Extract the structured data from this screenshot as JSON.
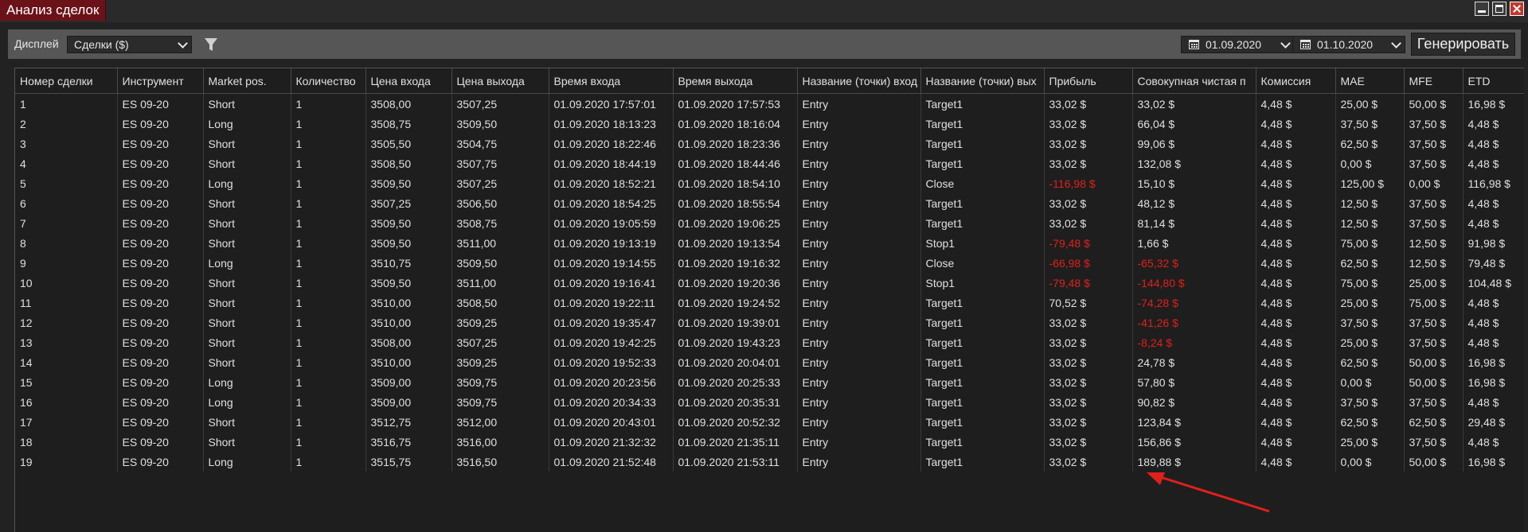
{
  "window": {
    "title": "Анализ сделок",
    "controls": [
      "minimize-icon",
      "maximize-icon",
      "close-icon"
    ]
  },
  "toolbar": {
    "display_label": "Дисплей",
    "display_value": "Сделки ($)",
    "filter_icon": "filter-icon",
    "date_from": "01.09.2020",
    "date_to": "01.10.2020",
    "generate_label": "Генерировать"
  },
  "table": {
    "columns": [
      "Номер сделки",
      "Инструмент",
      "Market pos.",
      "Количество",
      "Цена входа",
      "Цена выхода",
      "Время входа",
      "Время выхода",
      "Название (точки) вход",
      "Название (точки) вых",
      "Прибыль",
      "Совокупная чистая п",
      "Комиссия",
      "MAE",
      "MFE",
      "ETD"
    ],
    "rows": [
      [
        "1",
        "ES 09-20",
        "Short",
        "1",
        "3508,00",
        "3507,25",
        "01.09.2020 17:57:01",
        "01.09.2020 17:57:53",
        "Entry",
        "Target1",
        "33,02 $",
        "33,02 $",
        "4,48 $",
        "25,00 $",
        "50,00 $",
        "16,98 $"
      ],
      [
        "2",
        "ES 09-20",
        "Long",
        "1",
        "3508,75",
        "3509,50",
        "01.09.2020 18:13:23",
        "01.09.2020 18:16:04",
        "Entry",
        "Target1",
        "33,02 $",
        "66,04 $",
        "4,48 $",
        "37,50 $",
        "37,50 $",
        "4,48 $"
      ],
      [
        "3",
        "ES 09-20",
        "Short",
        "1",
        "3505,50",
        "3504,75",
        "01.09.2020 18:22:46",
        "01.09.2020 18:23:36",
        "Entry",
        "Target1",
        "33,02 $",
        "99,06 $",
        "4,48 $",
        "62,50 $",
        "37,50 $",
        "4,48 $"
      ],
      [
        "4",
        "ES 09-20",
        "Short",
        "1",
        "3508,50",
        "3507,75",
        "01.09.2020 18:44:19",
        "01.09.2020 18:44:46",
        "Entry",
        "Target1",
        "33,02 $",
        "132,08 $",
        "4,48 $",
        "0,00 $",
        "37,50 $",
        "4,48 $"
      ],
      [
        "5",
        "ES 09-20",
        "Long",
        "1",
        "3509,50",
        "3507,25",
        "01.09.2020 18:52:21",
        "01.09.2020 18:54:10",
        "Entry",
        "Close",
        "-116,98 $",
        "15,10 $",
        "4,48 $",
        "125,00 $",
        "0,00 $",
        "116,98 $"
      ],
      [
        "6",
        "ES 09-20",
        "Short",
        "1",
        "3507,25",
        "3506,50",
        "01.09.2020 18:54:25",
        "01.09.2020 18:55:54",
        "Entry",
        "Target1",
        "33,02 $",
        "48,12 $",
        "4,48 $",
        "12,50 $",
        "37,50 $",
        "4,48 $"
      ],
      [
        "7",
        "ES 09-20",
        "Short",
        "1",
        "3509,50",
        "3508,75",
        "01.09.2020 19:05:59",
        "01.09.2020 19:06:25",
        "Entry",
        "Target1",
        "33,02 $",
        "81,14 $",
        "4,48 $",
        "12,50 $",
        "37,50 $",
        "4,48 $"
      ],
      [
        "8",
        "ES 09-20",
        "Short",
        "1",
        "3509,50",
        "3511,00",
        "01.09.2020 19:13:19",
        "01.09.2020 19:13:54",
        "Entry",
        "Stop1",
        "-79,48 $",
        "1,66 $",
        "4,48 $",
        "75,00 $",
        "12,50 $",
        "91,98 $"
      ],
      [
        "9",
        "ES 09-20",
        "Long",
        "1",
        "3510,75",
        "3509,50",
        "01.09.2020 19:14:55",
        "01.09.2020 19:16:32",
        "Entry",
        "Close",
        "-66,98 $",
        "-65,32 $",
        "4,48 $",
        "62,50 $",
        "12,50 $",
        "79,48 $"
      ],
      [
        "10",
        "ES 09-20",
        "Short",
        "1",
        "3509,50",
        "3511,00",
        "01.09.2020 19:16:41",
        "01.09.2020 19:20:36",
        "Entry",
        "Stop1",
        "-79,48 $",
        "-144,80 $",
        "4,48 $",
        "75,00 $",
        "25,00 $",
        "104,48 $"
      ],
      [
        "11",
        "ES 09-20",
        "Short",
        "1",
        "3510,00",
        "3508,50",
        "01.09.2020 19:22:11",
        "01.09.2020 19:24:52",
        "Entry",
        "Target1",
        "70,52 $",
        "-74,28 $",
        "4,48 $",
        "25,00 $",
        "75,00 $",
        "4,48 $"
      ],
      [
        "12",
        "ES 09-20",
        "Short",
        "1",
        "3510,00",
        "3509,25",
        "01.09.2020 19:35:47",
        "01.09.2020 19:39:01",
        "Entry",
        "Target1",
        "33,02 $",
        "-41,26 $",
        "4,48 $",
        "37,50 $",
        "37,50 $",
        "4,48 $"
      ],
      [
        "13",
        "ES 09-20",
        "Short",
        "1",
        "3508,00",
        "3507,25",
        "01.09.2020 19:42:25",
        "01.09.2020 19:43:23",
        "Entry",
        "Target1",
        "33,02 $",
        "-8,24 $",
        "4,48 $",
        "25,00 $",
        "37,50 $",
        "4,48 $"
      ],
      [
        "14",
        "ES 09-20",
        "Short",
        "1",
        "3510,00",
        "3509,25",
        "01.09.2020 19:52:33",
        "01.09.2020 20:04:01",
        "Entry",
        "Target1",
        "33,02 $",
        "24,78 $",
        "4,48 $",
        "62,50 $",
        "50,00 $",
        "16,98 $"
      ],
      [
        "15",
        "ES 09-20",
        "Long",
        "1",
        "3509,00",
        "3509,75",
        "01.09.2020 20:23:56",
        "01.09.2020 20:25:33",
        "Entry",
        "Target1",
        "33,02 $",
        "57,80 $",
        "4,48 $",
        "0,00 $",
        "50,00 $",
        "16,98 $"
      ],
      [
        "16",
        "ES 09-20",
        "Long",
        "1",
        "3509,00",
        "3509,75",
        "01.09.2020 20:34:33",
        "01.09.2020 20:35:31",
        "Entry",
        "Target1",
        "33,02 $",
        "90,82 $",
        "4,48 $",
        "37,50 $",
        "37,50 $",
        "4,48 $"
      ],
      [
        "17",
        "ES 09-20",
        "Short",
        "1",
        "3512,75",
        "3512,00",
        "01.09.2020 20:43:01",
        "01.09.2020 20:52:32",
        "Entry",
        "Target1",
        "33,02 $",
        "123,84 $",
        "4,48 $",
        "62,50 $",
        "62,50 $",
        "29,48 $"
      ],
      [
        "18",
        "ES 09-20",
        "Short",
        "1",
        "3516,75",
        "3516,00",
        "01.09.2020 21:32:32",
        "01.09.2020 21:35:11",
        "Entry",
        "Target1",
        "33,02 $",
        "156,86 $",
        "4,48 $",
        "25,00 $",
        "37,50 $",
        "4,48 $"
      ],
      [
        "19",
        "ES 09-20",
        "Long",
        "1",
        "3515,75",
        "3516,50",
        "01.09.2020 21:52:48",
        "01.09.2020 21:53:11",
        "Entry",
        "Target1",
        "33,02 $",
        "189,88 $",
        "4,48 $",
        "0,00 $",
        "50,00 $",
        "16,98 $"
      ]
    ]
  },
  "colors": {
    "title_tab": "#6b1219",
    "negative": "#e0201a",
    "annotation_arrow": "#e0201a"
  },
  "annotation": {
    "arrow_icon": "red-arrow-annotation"
  }
}
